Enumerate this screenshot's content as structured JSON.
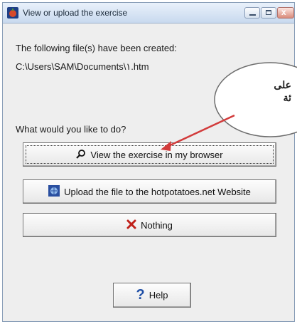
{
  "window": {
    "title": "View or upload the exercise"
  },
  "message": {
    "line1": "The following file(s) have been created:",
    "path": "C:\\Users\\SAM\\Documents\\۱.htm",
    "prompt": "What would you like to do?"
  },
  "callout": {
    "text": "على\nئة"
  },
  "buttons": {
    "view": {
      "label": "View the exercise in my browser",
      "icon": "magnifier-icon"
    },
    "upload": {
      "label": "Upload the file to the hotpotatoes.net Website",
      "icon": "hotpotatoes-upload-icon"
    },
    "nothing": {
      "label": "Nothing",
      "icon": "red-x-icon"
    },
    "help": {
      "label": "Help",
      "icon": "question-mark-icon"
    }
  },
  "colors": {
    "arrow": "#d23b3b",
    "x_mark": "#c0201a",
    "question_mark": "#1f4fa6"
  }
}
